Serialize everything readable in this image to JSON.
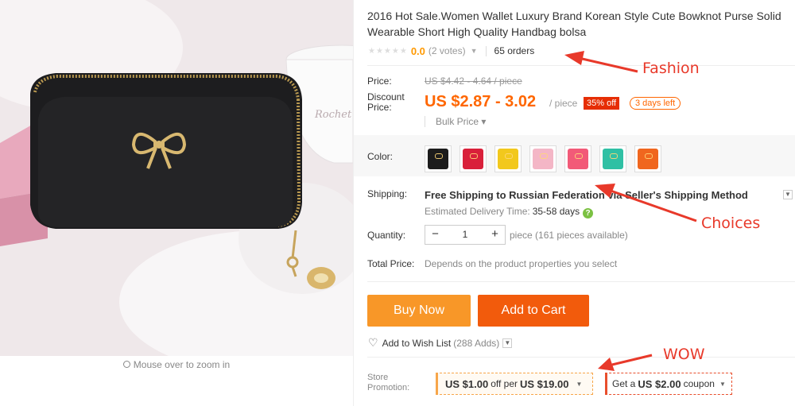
{
  "product": {
    "title": "2016 Hot Sale.Women Wallet Luxury Brand Korean Style Cute Bowknot Purse Solid Wearable Short High Quality Handbag bolsa",
    "rating_stars": "★★★★★",
    "rating_value": "0.0",
    "votes": "(2 votes)",
    "orders": "65 orders"
  },
  "gallery": {
    "zoom_hint": "Mouse over to zoom in",
    "cup_text": "Rochet"
  },
  "pricing": {
    "price_label": "Price:",
    "original_price": "US $4.42 - 4.64 / piece",
    "discount_label_1": "Discount",
    "discount_label_2": "Price:",
    "discount_price": "US $2.87 - 3.02",
    "unit": "/ piece",
    "discount_badge": "35% off",
    "days_left": "3 days left",
    "bulk_price": "Bulk Price ▾"
  },
  "color": {
    "label": "Color:",
    "swatches": [
      "#1c1c1c",
      "#d9203a",
      "#f2c81c",
      "#f4b6c6",
      "#f25a78",
      "#2fc0a4",
      "#f0661e"
    ]
  },
  "shipping": {
    "label": "Shipping:",
    "method": "Free Shipping to Russian Federation via Seller's Shipping Method",
    "estimate_label": "Estimated Delivery Time:",
    "estimate_value": "35-58 days",
    "help": "?"
  },
  "quantity": {
    "label": "Quantity:",
    "minus": "−",
    "value": "1",
    "plus": "+",
    "info": "piece (161 pieces available)"
  },
  "total": {
    "label": "Total Price:",
    "note": "Depends on the product properties you select"
  },
  "actions": {
    "buy_now": "Buy Now",
    "add_to_cart": "Add to Cart",
    "wish_list": "Add to Wish List",
    "wish_count": "(288 Adds)"
  },
  "promotion": {
    "label_1": "Store",
    "label_2": "Promotion:",
    "coupon1_a": "US $1.00",
    "coupon1_b": "off per",
    "coupon1_c": "US $19.00",
    "coupon2_a": "Get a",
    "coupon2_b": "US $2.00",
    "coupon2_c": "coupon"
  },
  "annotations": {
    "fashion": "Fashion",
    "choices": "Choices",
    "wow": "WOW",
    "color": "#e8392a"
  }
}
